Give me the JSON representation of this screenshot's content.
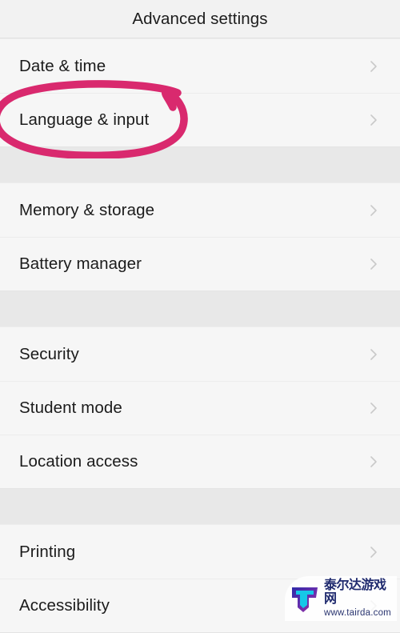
{
  "header": {
    "title": "Advanced settings"
  },
  "colors": {
    "page_background": "#f6f6f6",
    "group_gap": "#e8e8e8",
    "row_background": "#f6f6f6",
    "row_text": "#1b1b1b",
    "chevron": "#c9c9c9",
    "annotation_ink": "#d9296e",
    "watermark_text": "#1f2a6e"
  },
  "icons": {
    "chevron_right": "chevron-right-icon"
  },
  "list": {
    "groups": [
      {
        "rows": [
          {
            "label": "Date & time",
            "chevron": true,
            "highlighted": false
          },
          {
            "label": "Language & input",
            "chevron": true,
            "highlighted": true
          }
        ]
      },
      {
        "rows": [
          {
            "label": "Memory & storage",
            "chevron": true,
            "highlighted": false
          },
          {
            "label": "Battery manager",
            "chevron": true,
            "highlighted": false
          }
        ]
      },
      {
        "rows": [
          {
            "label": "Security",
            "chevron": true,
            "highlighted": false
          },
          {
            "label": "Student mode",
            "chevron": true,
            "highlighted": false
          },
          {
            "label": "Location access",
            "chevron": true,
            "highlighted": false
          }
        ]
      },
      {
        "rows": [
          {
            "label": "Printing",
            "chevron": true,
            "highlighted": false
          },
          {
            "label": "Accessibility",
            "chevron": true,
            "highlighted": false
          }
        ]
      }
    ]
  },
  "annotation": {
    "kind": "hand-drawn-ellipse",
    "target_label": "Language & input",
    "color": "#d9296e"
  },
  "watermark": {
    "name_cn": "泰尔达游戏网",
    "url": "www.tairda.com"
  }
}
